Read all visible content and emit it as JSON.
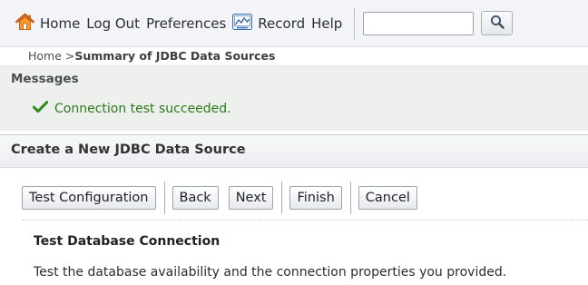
{
  "toolbar": {
    "home_label": "Home",
    "logout_label": "Log Out",
    "preferences_label": "Preferences",
    "record_label": "Record",
    "help_label": "Help",
    "search_value": ""
  },
  "breadcrumb": {
    "home": "Home >",
    "current": "Summary of JDBC Data Sources"
  },
  "messages": {
    "title": "Messages",
    "items": [
      {
        "text": "Connection test succeeded.",
        "status": "success"
      }
    ]
  },
  "panel": {
    "title": "Create a New JDBC Data Source",
    "buttons": {
      "test_configuration": "Test Configuration",
      "back": "Back",
      "next": "Next",
      "finish": "Finish",
      "cancel": "Cancel"
    },
    "section_title": "Test Database Connection",
    "section_description": "Test the database availability and the connection properties you provided."
  },
  "colors": {
    "success": "#2a7a19",
    "home_icon": "#e2781c",
    "toolbar_bg": "#f2f4f7",
    "messages_bg": "#eef0ee"
  },
  "icons": [
    "home-icon",
    "record-icon",
    "search-icon",
    "checkmark-icon"
  ]
}
